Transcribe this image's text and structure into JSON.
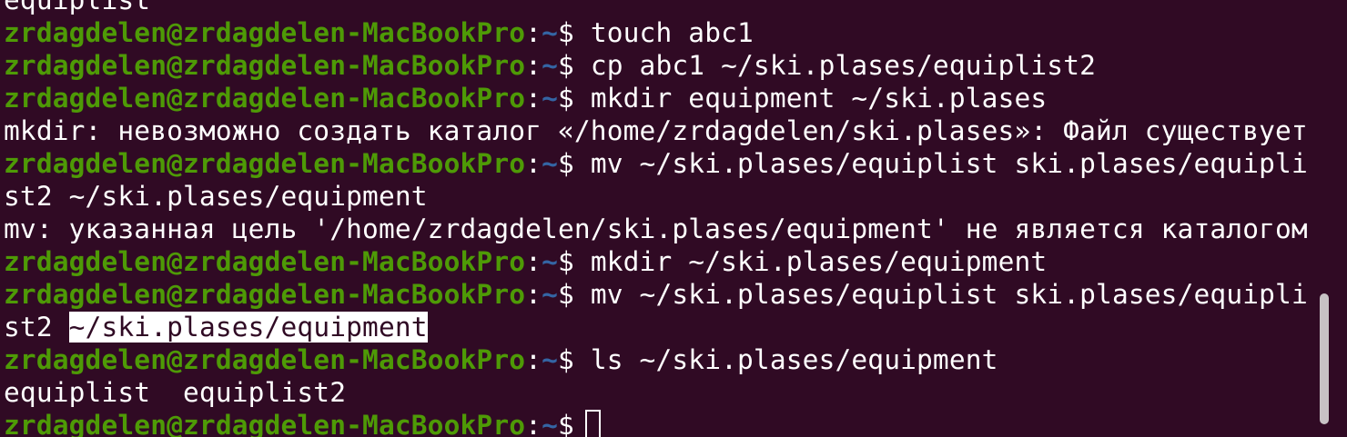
{
  "terminal": {
    "prompt": {
      "user_host": "zrdagdelen@zrdagdelen-MacBookPro",
      "colon": ":",
      "path": "~",
      "symbol": "$"
    },
    "lines": [
      {
        "type": "output",
        "text": "equiplist"
      },
      {
        "type": "prompt",
        "command": " touch abc1"
      },
      {
        "type": "prompt",
        "command": " cp abc1 ~/ski.plases/equiplist2"
      },
      {
        "type": "prompt",
        "command": " mkdir equipment ~/ski.plases"
      },
      {
        "type": "output",
        "text": "mkdir: невозможно создать каталог «/home/zrdagdelen/ski.plases»: Файл существует"
      },
      {
        "type": "prompt",
        "command": " mv ~/ski.plases/equiplist ski.plases/equipli"
      },
      {
        "type": "output",
        "text": "st2 ~/ski.plases/equipment"
      },
      {
        "type": "output",
        "text": "mv: указанная цель '/home/zrdagdelen/ski.plases/equipment' не является каталогом"
      },
      {
        "type": "prompt",
        "command": " mkdir ~/ski.plases/equipment"
      },
      {
        "type": "prompt",
        "command": " mv ~/ski.plases/equiplist ski.plases/equipli"
      },
      {
        "type": "output_selected",
        "text": "st2 ",
        "selected": "~/ski.plases/equipment"
      },
      {
        "type": "prompt",
        "command": " ls ~/ski.plases/equipment"
      },
      {
        "type": "output",
        "text": "equiplist  equiplist2"
      },
      {
        "type": "prompt_cursor",
        "command": ""
      }
    ]
  },
  "colors": {
    "background": "#300a24",
    "user_host": "#4e9a06",
    "path": "#3465a4",
    "text": "#ffffff"
  }
}
